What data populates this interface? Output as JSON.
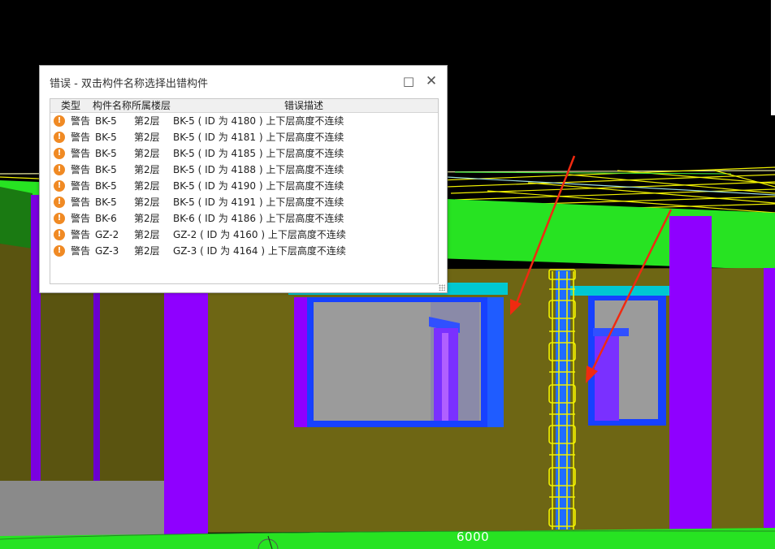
{
  "colors": {
    "wall": "#6e6614",
    "floor": "#27e322",
    "column_purple": "#8f00ff",
    "window_blue": "#1741ff",
    "glass": "#9b9b9b",
    "lintel_cyan": "#00c8d2",
    "rebar_yellow": "#f0f000",
    "arrow_red": "#f02a10",
    "warning_orange": "#f08a24"
  },
  "viewport": {
    "ruler_label": "6000"
  },
  "dialog": {
    "title": "错误 - 双击构件名称选择出错构件",
    "maximize_icon": "□",
    "close_icon": "✕",
    "columns": [
      "类型",
      "构件名称",
      "所属楼层",
      "错误描述"
    ],
    "rows": [
      {
        "type": "警告",
        "name": "BK-5",
        "floor": "第2层",
        "desc": "BK-5 ( ID 为 4180 ) 上下层高度不连续"
      },
      {
        "type": "警告",
        "name": "BK-5",
        "floor": "第2层",
        "desc": "BK-5 ( ID 为 4181 ) 上下层高度不连续"
      },
      {
        "type": "警告",
        "name": "BK-5",
        "floor": "第2层",
        "desc": "BK-5 ( ID 为 4185 ) 上下层高度不连续"
      },
      {
        "type": "警告",
        "name": "BK-5",
        "floor": "第2层",
        "desc": "BK-5 ( ID 为 4188 ) 上下层高度不连续"
      },
      {
        "type": "警告",
        "name": "BK-5",
        "floor": "第2层",
        "desc": "BK-5 ( ID 为 4190 ) 上下层高度不连续"
      },
      {
        "type": "警告",
        "name": "BK-5",
        "floor": "第2层",
        "desc": "BK-5 ( ID 为 4191 ) 上下层高度不连续"
      },
      {
        "type": "警告",
        "name": "BK-6",
        "floor": "第2层",
        "desc": "BK-6 ( ID 为 4186 ) 上下层高度不连续"
      },
      {
        "type": "警告",
        "name": "GZ-2",
        "floor": "第2层",
        "desc": "GZ-2 ( ID 为 4160 ) 上下层高度不连续"
      },
      {
        "type": "警告",
        "name": "GZ-3",
        "floor": "第2层",
        "desc": "GZ-3 ( ID 为 4164 ) 上下层高度不连续"
      }
    ]
  }
}
